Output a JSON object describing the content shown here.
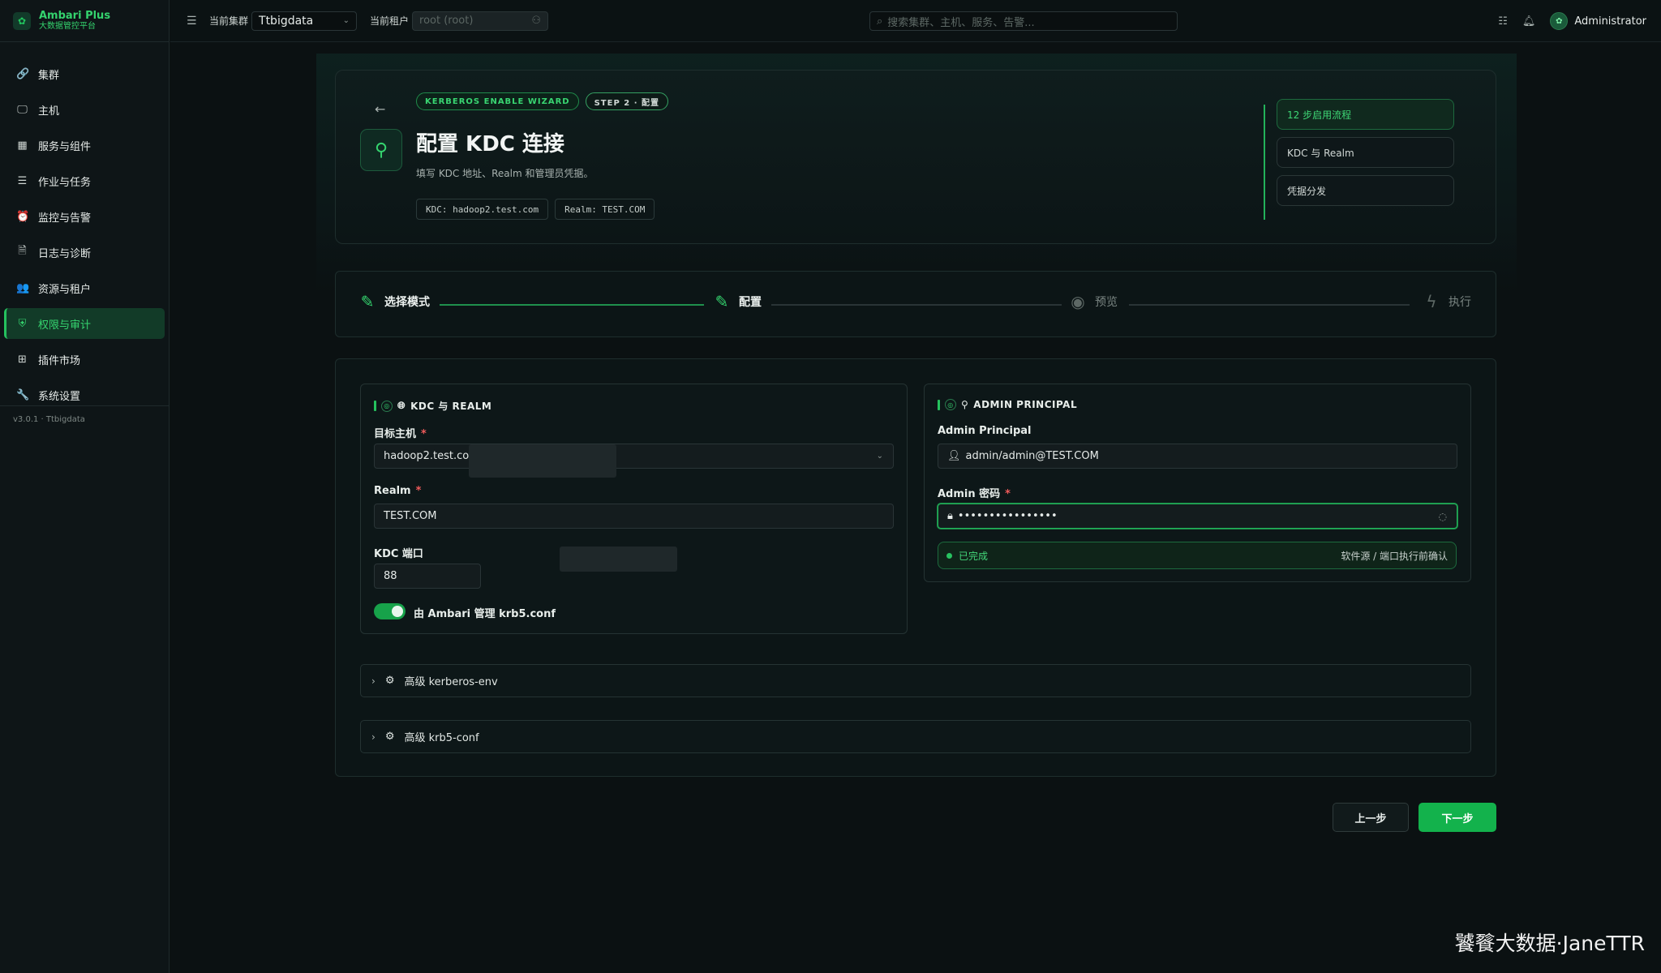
{
  "brand": {
    "name": "Ambari Plus",
    "subtitle": "大数据管控平台",
    "logo_icon": "tree-logo-icon"
  },
  "sidebar": {
    "items": [
      {
        "label": "集群",
        "icon": "link-icon",
        "glyph": "🔗"
      },
      {
        "label": "主机",
        "icon": "monitor-icon",
        "glyph": "🖵"
      },
      {
        "label": "服务与组件",
        "icon": "grid-icon",
        "glyph": "▦"
      },
      {
        "label": "作业与任务",
        "icon": "list-icon",
        "glyph": "☰"
      },
      {
        "label": "监控与告警",
        "icon": "alarm-icon",
        "glyph": "⏰"
      },
      {
        "label": "日志与诊断",
        "icon": "log-icon",
        "glyph": "🗎"
      },
      {
        "label": "资源与租户",
        "icon": "users-icon",
        "glyph": "👥"
      },
      {
        "label": "权限与审计",
        "icon": "shield-icon",
        "glyph": "⛨",
        "active": true
      },
      {
        "label": "插件市场",
        "icon": "plugin-icon",
        "glyph": "⊞"
      },
      {
        "label": "系统设置",
        "icon": "wrench-icon",
        "glyph": "🔧"
      }
    ],
    "version": "v3.0.1 · Ttbigdata"
  },
  "topbar": {
    "cluster_label": "当前集群",
    "cluster_value": "Ttbigdata",
    "tenant_label": "当前租户",
    "tenant_placeholder": "root (root)",
    "search_placeholder": "搜索集群、主机、服务、告警...",
    "user_name": "Administrator"
  },
  "hero": {
    "badge_wizard": "KERBEROS ENABLE WIZARD",
    "badge_step": "STEP 2 · 配置",
    "title": "配置 KDC 连接",
    "subtitle": "填写 KDC 地址、Realm 和管理员凭据。",
    "chip_kdc": "KDC: hadoop2.test.com",
    "chip_realm": "Realm: TEST.COM",
    "side_steps": [
      "12 步启用流程",
      "KDC 与 Realm",
      "凭据分发"
    ]
  },
  "stepper": {
    "steps": [
      {
        "label": "选择模式",
        "state": "done"
      },
      {
        "label": "配置",
        "state": "current"
      },
      {
        "label": "预览",
        "state": "pending"
      },
      {
        "label": "执行",
        "state": "pending"
      }
    ]
  },
  "kdc_card": {
    "title": "KDC 与 REALM",
    "host_label": "目标主机",
    "host_value": "hadoop2.test.con",
    "realm_label": "Realm",
    "realm_value": "TEST.COM",
    "port_label": "KDC 端口",
    "port_value": "88",
    "toggle_label": "由 Ambari 管理 krb5.conf",
    "toggle_on": true
  },
  "admin_card": {
    "title": "ADMIN PRINCIPAL",
    "principal_label": "Admin Principal",
    "principal_value": "admin/admin@TEST.COM",
    "password_label": "Admin 密码",
    "password_mask": "••••••••••••••••",
    "status_text": "已完成",
    "status_right": "软件源 / 端口执行前确认"
  },
  "accordions": {
    "kerberos_env": "高级 kerberos-env",
    "krb5_conf": "高级 krb5-conf"
  },
  "buttons": {
    "prev": "上一步",
    "next": "下一步"
  },
  "watermark": "饕餮大数据·JaneTTR",
  "colors": {
    "accent": "#25c25e",
    "background": "#0b1112"
  }
}
